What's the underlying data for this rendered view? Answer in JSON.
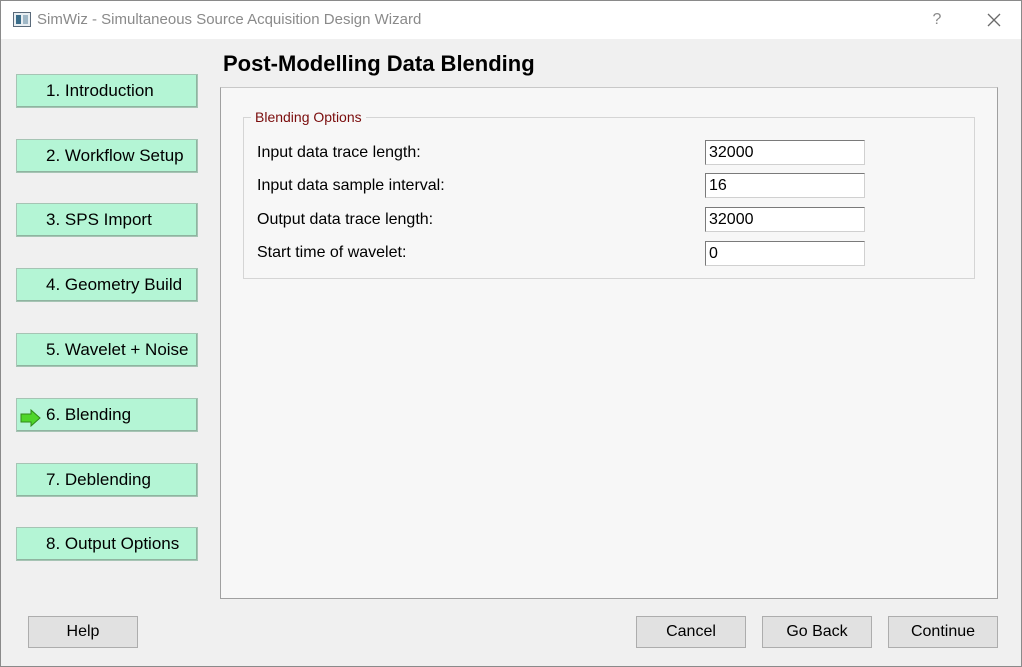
{
  "window": {
    "title": "SimWiz - Simultaneous Source Acquisition Design Wizard",
    "help_glyph": "?",
    "app_icon": "window-app-icon",
    "close_icon": "close-icon"
  },
  "nav": {
    "active_index": 5,
    "active_icon": "right-arrow-icon",
    "items": [
      {
        "label": "1. Introduction"
      },
      {
        "label": "2. Workflow Setup"
      },
      {
        "label": "3. SPS Import"
      },
      {
        "label": "4. Geometry Build"
      },
      {
        "label": "5. Wavelet + Noise"
      },
      {
        "label": "6. Blending"
      },
      {
        "label": "7. Deblending"
      },
      {
        "label": "8. Output Options"
      }
    ]
  },
  "page": {
    "title": "Post-Modelling Data Blending",
    "group_title": "Blending Options",
    "fields": [
      {
        "label": "Input data trace length:",
        "value": "32000"
      },
      {
        "label": "Input data sample interval:",
        "value": "16"
      },
      {
        "label": "Output data trace length:",
        "value": "32000"
      },
      {
        "label": "Start time of wavelet:",
        "value": "0"
      }
    ]
  },
  "buttons": {
    "help": "Help",
    "cancel": "Cancel",
    "go_back": "Go Back",
    "continue": "Continue"
  },
  "colors": {
    "nav_button_bg": "#b4f5d5",
    "group_title": "#7a0c0c",
    "active_arrow": "#4fd62a"
  }
}
